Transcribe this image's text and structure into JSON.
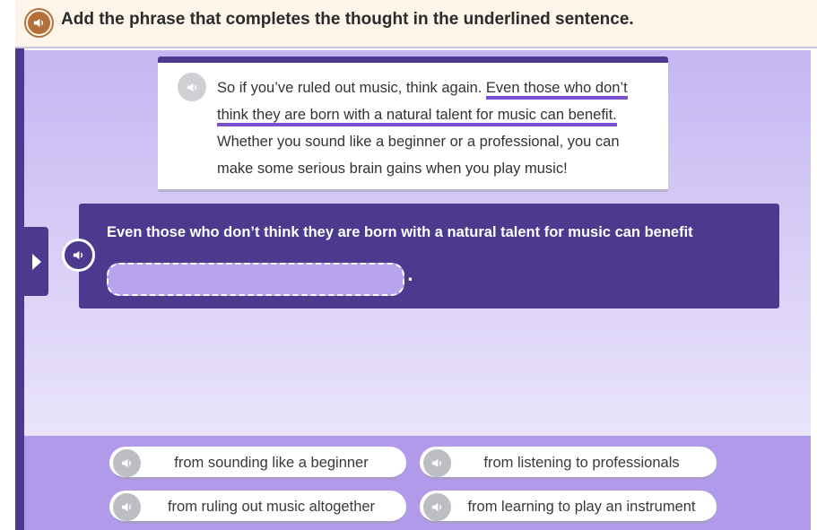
{
  "header": {
    "instruction": "Add the phrase that completes the thought in the underlined sentence.",
    "audio_icon": "speaker-icon"
  },
  "passage": {
    "text_before": "So if you’ve ruled out music, think again. ",
    "underlined_sentence": "Even those who don’t think they are born with a natural talent for music can benefit.",
    "text_after": " Whether you sound like a beginner or a professional, you can make some serious brain gains when you play music!"
  },
  "question": {
    "stem": "Even those who don’t think they are born with a natural talent for music can benefit",
    "blank_suffix": "."
  },
  "choices": [
    {
      "label": "from sounding like a beginner"
    },
    {
      "label": "from listening to professionals"
    },
    {
      "label": "from ruling out music altogether"
    },
    {
      "label": "from learning to play an instrument"
    }
  ],
  "colors": {
    "accent_purple": "#4c3a8f",
    "underline_purple": "#7d4fcf",
    "header_audio": "#b3703a"
  }
}
